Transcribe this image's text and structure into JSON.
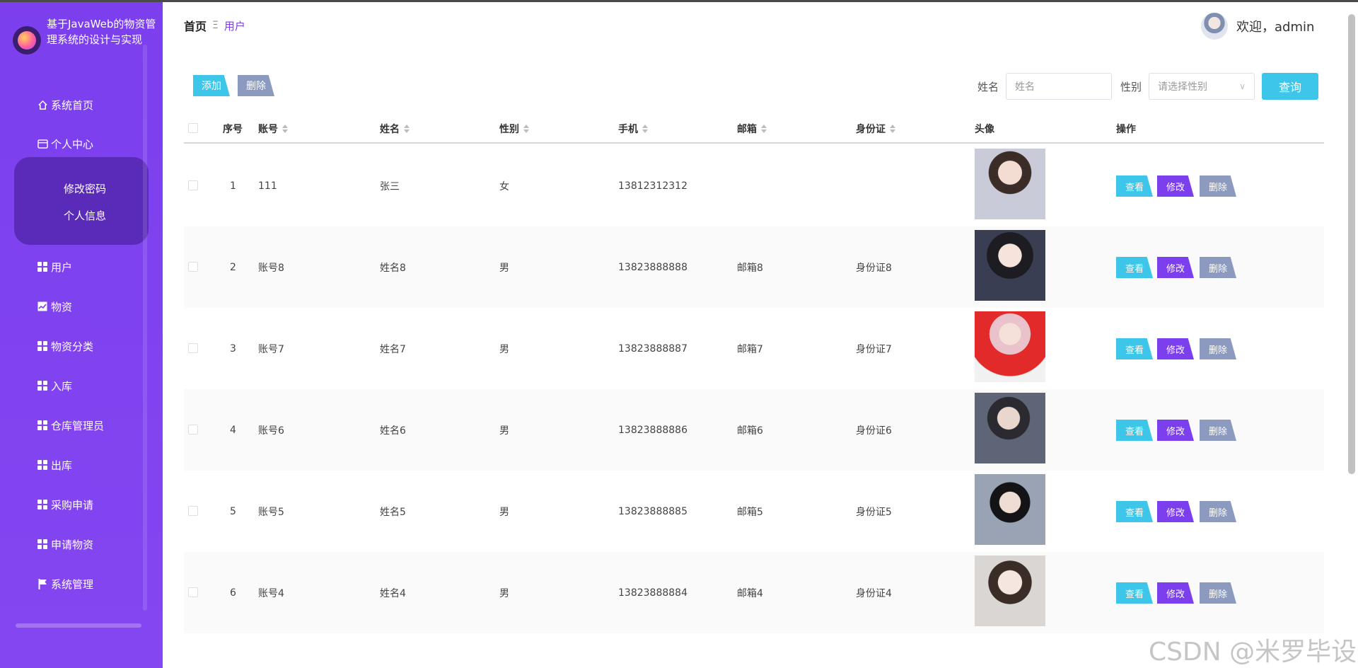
{
  "sidebar": {
    "title": "基于JavaWeb的物资管理系统的设计与实现",
    "menu": [
      {
        "label": "系统首页",
        "icon": "home-icon"
      },
      {
        "label": "个人中心",
        "icon": "card-icon"
      },
      {
        "label": "用户",
        "icon": "grid-icon"
      },
      {
        "label": "物资",
        "icon": "chart-icon"
      },
      {
        "label": "物资分类",
        "icon": "grid-icon"
      },
      {
        "label": "入库",
        "icon": "grid-icon"
      },
      {
        "label": "仓库管理员",
        "icon": "grid-icon"
      },
      {
        "label": "出库",
        "icon": "grid-icon"
      },
      {
        "label": "采购申请",
        "icon": "grid-icon"
      },
      {
        "label": "申请物资",
        "icon": "grid-icon"
      },
      {
        "label": "系统管理",
        "icon": "flag-icon"
      }
    ],
    "submenu": [
      "修改密码",
      "个人信息"
    ]
  },
  "header": {
    "breadcrumb_home": "首页",
    "breadcrumb_sep": "Ξ",
    "breadcrumb_current": "用户",
    "welcome": "欢迎，admin"
  },
  "toolbar": {
    "add_label": "添加",
    "delete_label": "删除",
    "name_label": "姓名",
    "name_placeholder": "姓名",
    "gender_label": "性别",
    "gender_placeholder": "请选择性别",
    "query_label": "查询"
  },
  "table": {
    "columns": [
      "序号",
      "账号",
      "姓名",
      "性别",
      "手机",
      "邮箱",
      "身份证",
      "头像",
      "操作"
    ],
    "rows": [
      {
        "index": "1",
        "account": "111",
        "name": "张三",
        "gender": "女",
        "phone": "13812312312",
        "email": "",
        "idcard": ""
      },
      {
        "index": "2",
        "account": "账号8",
        "name": "姓名8",
        "gender": "男",
        "phone": "13823888888",
        "email": "邮箱8",
        "idcard": "身份证8"
      },
      {
        "index": "3",
        "account": "账号7",
        "name": "姓名7",
        "gender": "男",
        "phone": "13823888887",
        "email": "邮箱7",
        "idcard": "身份证7"
      },
      {
        "index": "4",
        "account": "账号6",
        "name": "姓名6",
        "gender": "男",
        "phone": "13823888886",
        "email": "邮箱6",
        "idcard": "身份证6"
      },
      {
        "index": "5",
        "account": "账号5",
        "name": "姓名5",
        "gender": "男",
        "phone": "13823888885",
        "email": "邮箱5",
        "idcard": "身份证5"
      },
      {
        "index": "6",
        "account": "账号4",
        "name": "姓名4",
        "gender": "男",
        "phone": "13823888884",
        "email": "邮箱4",
        "idcard": "身份证4"
      }
    ],
    "actions": {
      "view": "查看",
      "edit": "修改",
      "delete": "删除"
    }
  },
  "watermark": "CSDN @米罗毕设",
  "colors": {
    "sidebar": "#7b3fee",
    "submenu": "#5a2bb8",
    "cyan": "#3ec6ea",
    "purple": "#7b3fee",
    "gray": "#8c9abf"
  }
}
